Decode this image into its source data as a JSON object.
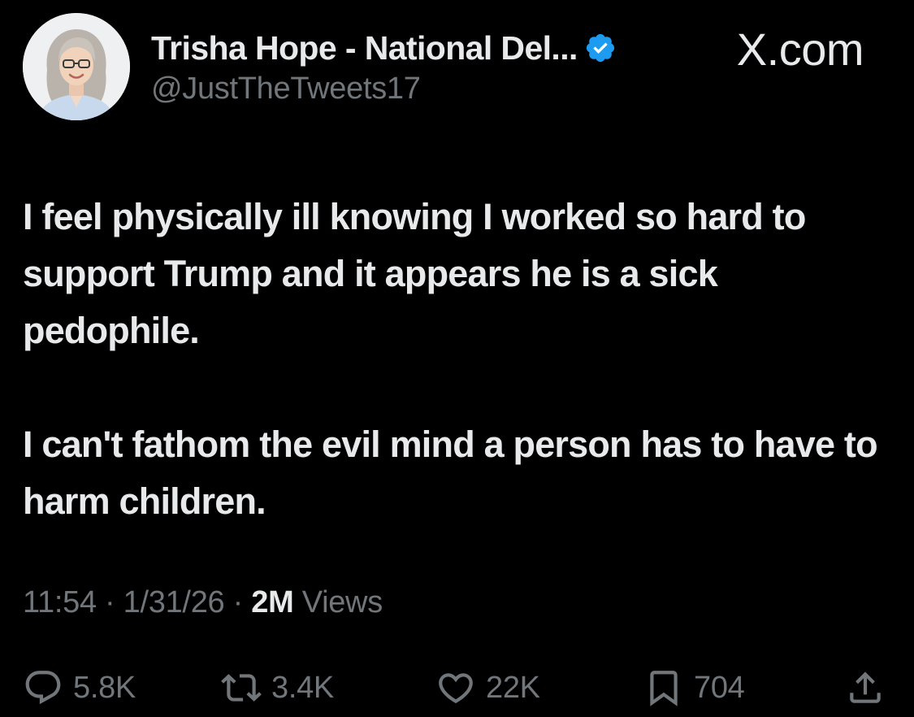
{
  "author": {
    "display_name": "Trisha Hope - National Del...",
    "handle": "@JustTheTweets17",
    "verified": true,
    "avatar_icon": "profile-photo"
  },
  "site": {
    "label": "X.com"
  },
  "tweet": {
    "paragraphs": [
      "I feel physically ill knowing I worked so hard to support Trump and it appears he is a sick pedophile.",
      "I can't fathom the evil mind a person has to have to harm children."
    ],
    "time": "11:54",
    "date": "1/31/26",
    "separator": "·",
    "views_count": "2M",
    "views_label": "Views"
  },
  "actions": {
    "replies": "5.8K",
    "reposts": "3.4K",
    "likes": "22K",
    "bookmarks": "704"
  },
  "icons": {
    "reply": "reply-icon",
    "repost": "repost-icon",
    "like": "heart-icon",
    "bookmark": "bookmark-icon",
    "share": "share-icon",
    "verified": "verified-badge-icon"
  },
  "colors": {
    "background": "#000000",
    "primary_text": "#e7e9ea",
    "secondary_text": "#71767b",
    "verified_blue": "#1d9bf0"
  }
}
